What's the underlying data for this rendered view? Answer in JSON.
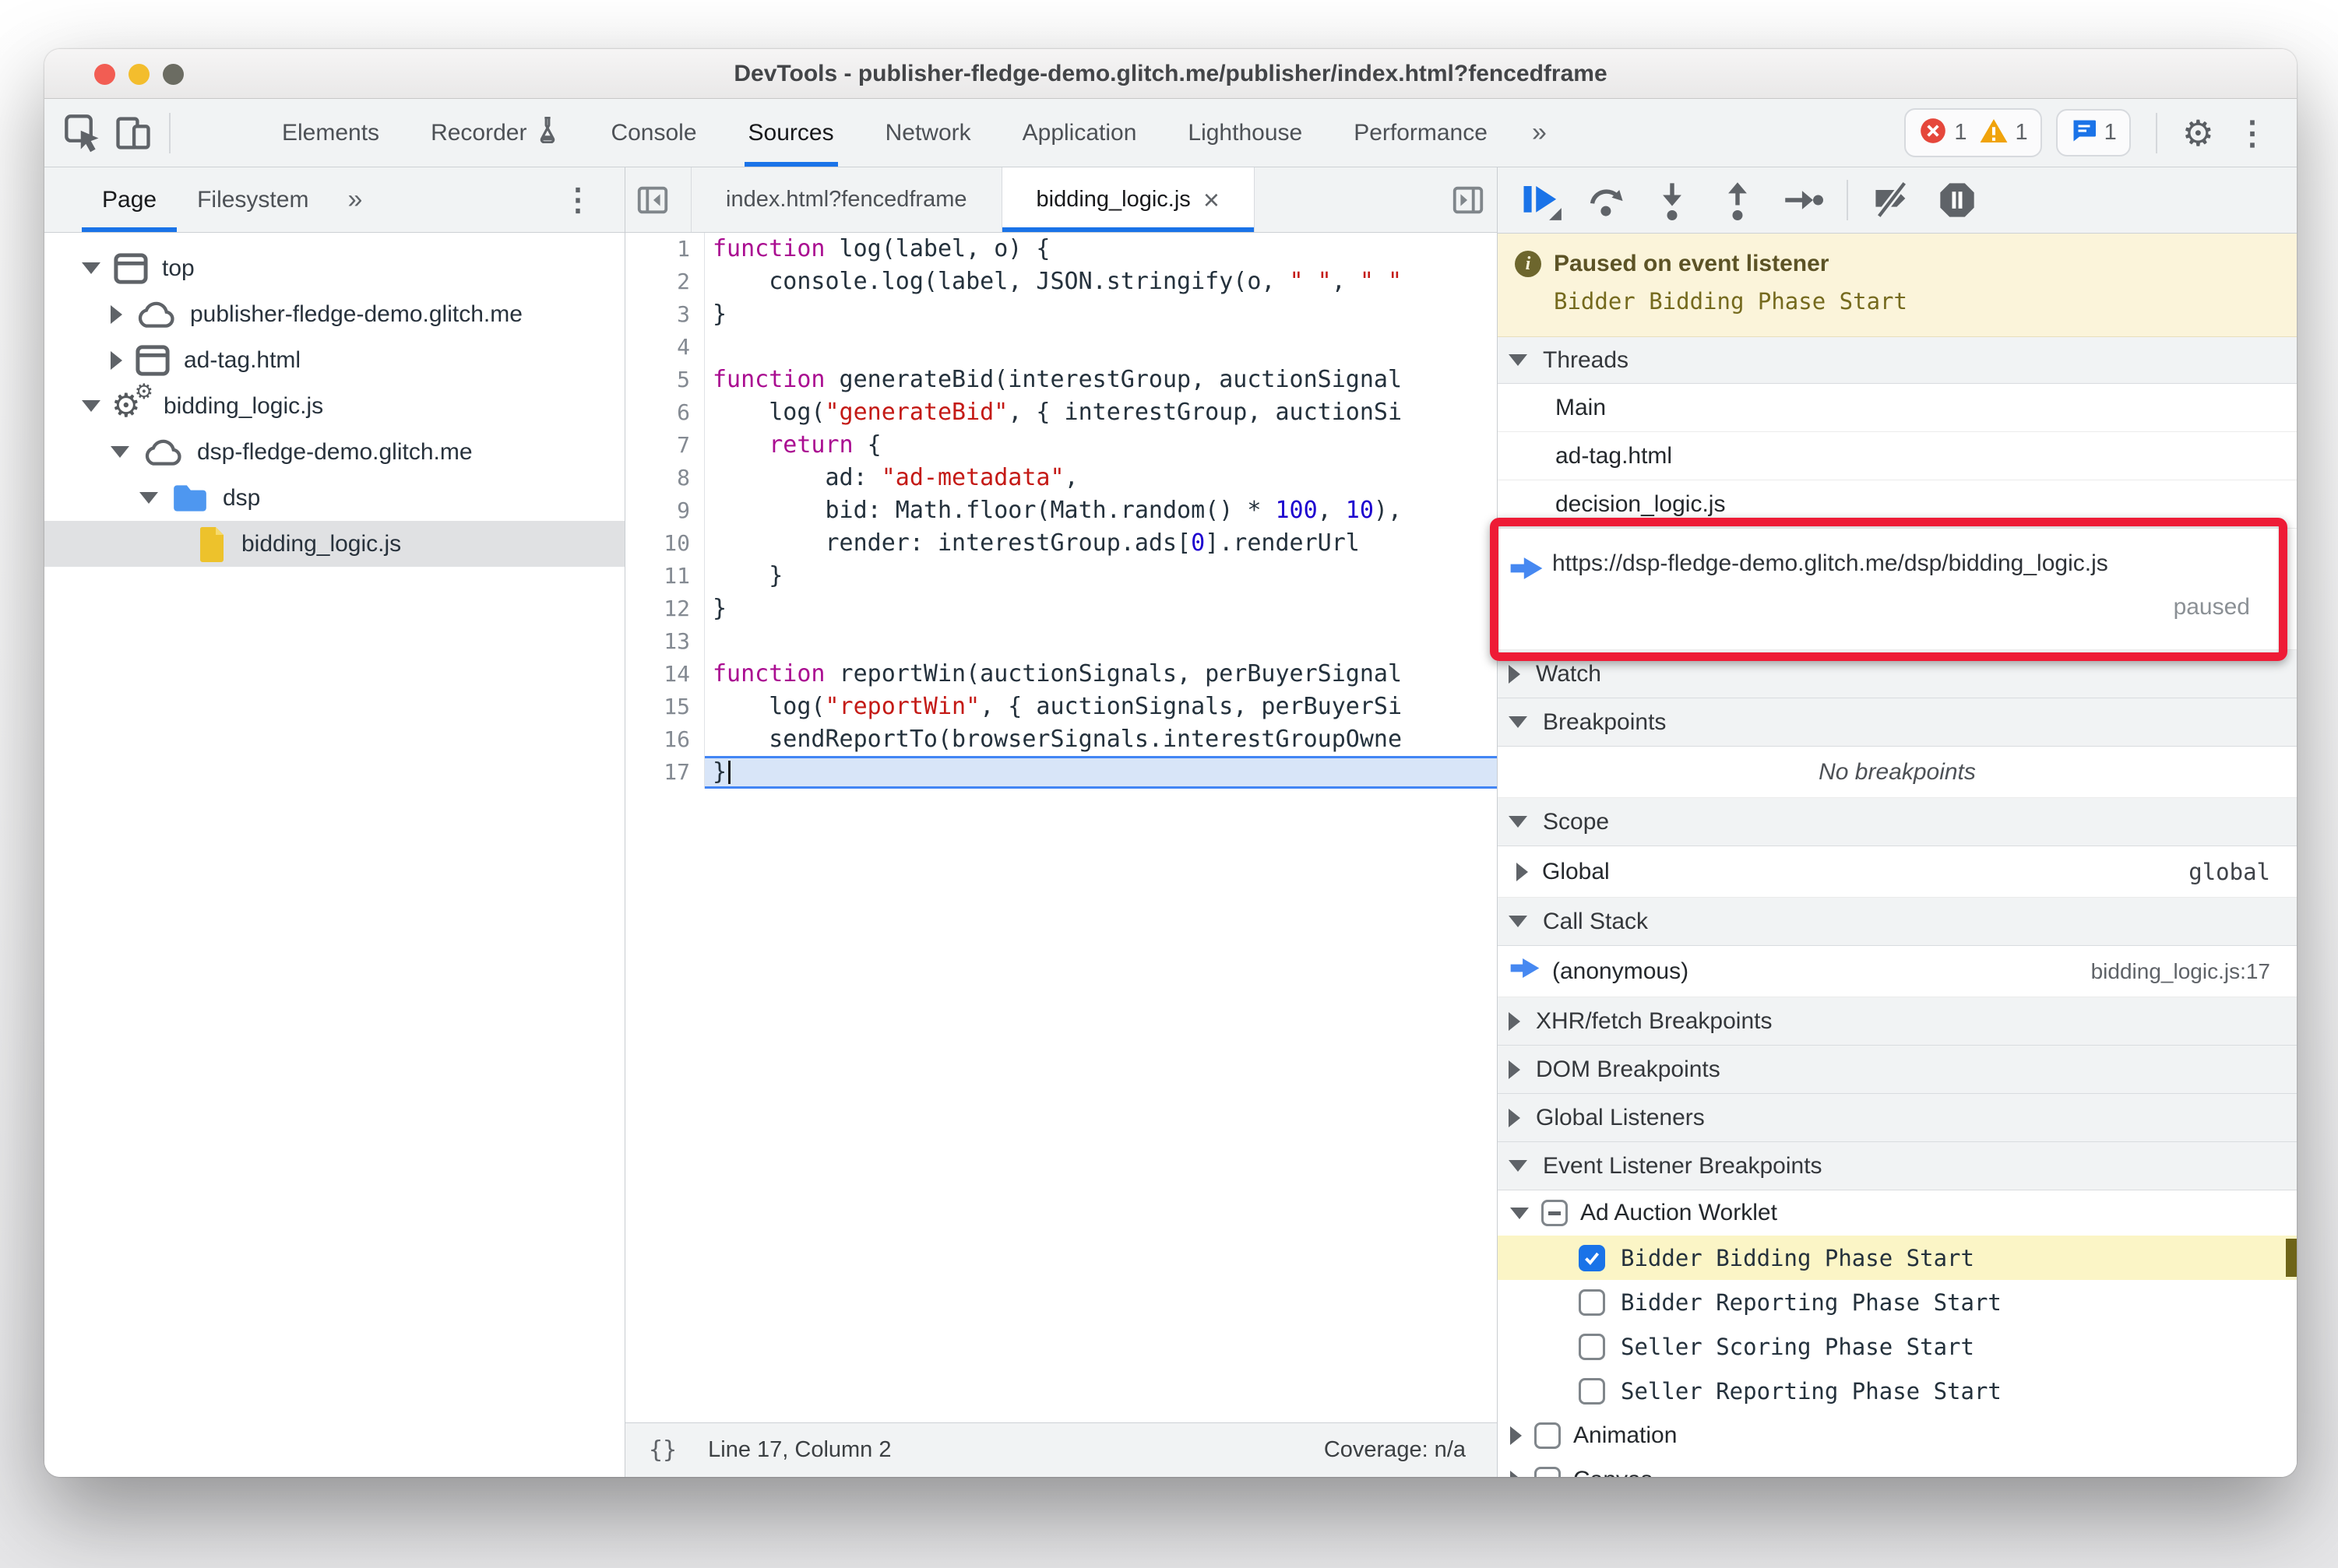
{
  "window": {
    "title": "DevTools - publisher-fledge-demo.glitch.me/publisher/index.html?fencedframe"
  },
  "toolbar": {
    "tabs": [
      {
        "label": "Elements"
      },
      {
        "label": "Recorder",
        "icon": "flask-icon"
      },
      {
        "label": "Console"
      },
      {
        "label": "Sources",
        "active": true
      },
      {
        "label": "Network"
      },
      {
        "label": "Application"
      },
      {
        "label": "Lighthouse"
      },
      {
        "label": "Performance"
      }
    ],
    "more": "»",
    "errors": "1",
    "warnings": "1",
    "issues": "1"
  },
  "navigator": {
    "tabs": [
      {
        "label": "Page",
        "active": true
      },
      {
        "label": "Filesystem",
        "active": false
      }
    ],
    "more": "»",
    "tree": [
      {
        "label": "top",
        "icon": "frame",
        "state": "expanded",
        "depth": 0
      },
      {
        "label": "publisher-fledge-demo.glitch.me",
        "icon": "cloud",
        "state": "collapsed",
        "depth": 1
      },
      {
        "label": "ad-tag.html",
        "icon": "frame",
        "state": "collapsed",
        "depth": 1
      },
      {
        "label": "bidding_logic.js",
        "icon": "worklet",
        "state": "expanded",
        "depth": 0
      },
      {
        "label": "dsp-fledge-demo.glitch.me",
        "icon": "cloud",
        "state": "expanded",
        "depth": 1
      },
      {
        "label": "dsp",
        "icon": "folder",
        "state": "expanded",
        "depth": 2
      },
      {
        "label": "bidding_logic.js",
        "icon": "file",
        "state": "leaf",
        "depth": 3,
        "selected": true
      }
    ]
  },
  "editor": {
    "tabs": [
      {
        "label": "index.html?fencedframe",
        "active": false
      },
      {
        "label": "bidding_logic.js",
        "active": true,
        "close": "×"
      }
    ],
    "code": [
      {
        "n": 1,
        "segs": [
          [
            "k",
            "function"
          ],
          [
            "p",
            " log(label, o) {"
          ]
        ]
      },
      {
        "n": 2,
        "segs": [
          [
            "p",
            "    console.log(label, JSON.stringify(o, "
          ],
          [
            "s",
            "\" \""
          ],
          [
            "p",
            ", "
          ],
          [
            "s",
            "\" \""
          ]
        ]
      },
      {
        "n": 3,
        "segs": [
          [
            "p",
            "}"
          ]
        ]
      },
      {
        "n": 4,
        "segs": []
      },
      {
        "n": 5,
        "segs": [
          [
            "k",
            "function"
          ],
          [
            "p",
            " generateBid(interestGroup, auctionSignal"
          ]
        ]
      },
      {
        "n": 6,
        "segs": [
          [
            "p",
            "    log("
          ],
          [
            "s",
            "\"generateBid\""
          ],
          [
            "p",
            ", { interestGroup, auctionSi"
          ]
        ]
      },
      {
        "n": 7,
        "segs": [
          [
            "p",
            "    "
          ],
          [
            "k",
            "return"
          ],
          [
            "p",
            " {"
          ]
        ]
      },
      {
        "n": 8,
        "segs": [
          [
            "p",
            "        ad: "
          ],
          [
            "s",
            "\"ad-metadata\""
          ],
          [
            "p",
            ","
          ]
        ]
      },
      {
        "n": 9,
        "segs": [
          [
            "p",
            "        bid: Math.floor(Math.random() * "
          ],
          [
            "n2",
            "100"
          ],
          [
            "p",
            ", "
          ],
          [
            "n2",
            "10"
          ],
          [
            "p",
            "),"
          ]
        ]
      },
      {
        "n": 10,
        "segs": [
          [
            "p",
            "        render: interestGroup.ads["
          ],
          [
            "n2",
            "0"
          ],
          [
            "p",
            "].renderUrl"
          ]
        ]
      },
      {
        "n": 11,
        "segs": [
          [
            "p",
            "    }"
          ]
        ]
      },
      {
        "n": 12,
        "segs": [
          [
            "p",
            "}"
          ]
        ]
      },
      {
        "n": 13,
        "segs": []
      },
      {
        "n": 14,
        "segs": [
          [
            "k",
            "function"
          ],
          [
            "p",
            " reportWin(auctionSignals, perBuyerSignal"
          ]
        ]
      },
      {
        "n": 15,
        "segs": [
          [
            "p",
            "    log("
          ],
          [
            "s",
            "\"reportWin\""
          ],
          [
            "p",
            ", { auctionSignals, perBuyerSi"
          ]
        ]
      },
      {
        "n": 16,
        "segs": [
          [
            "p",
            "    sendReportTo(browserSignals.interestGroupOwne"
          ]
        ]
      },
      {
        "n": 17,
        "segs": [
          [
            "p",
            "}"
          ]
        ],
        "current": true
      }
    ],
    "status": {
      "format_icon": "{}",
      "line_col": "Line 17, Column 2",
      "coverage": "Coverage: n/a"
    }
  },
  "debugger": {
    "paused": {
      "title": "Paused on event listener",
      "subtitle": "Bidder Bidding Phase Start"
    },
    "threads": {
      "label": "Threads",
      "items": [
        {
          "label": "Main"
        },
        {
          "label": "ad-tag.html"
        },
        {
          "label": "decision_logic.js"
        },
        {
          "label": "https://dsp-fledge-demo.glitch.me/dsp/bidding_logic.js",
          "status": "paused",
          "current": true
        }
      ]
    },
    "watch": {
      "label": "Watch"
    },
    "breakpoints": {
      "label": "Breakpoints",
      "empty": "No breakpoints"
    },
    "scope": {
      "label": "Scope",
      "rows": [
        {
          "label": "Global",
          "value": "global"
        }
      ]
    },
    "call_stack": {
      "label": "Call Stack",
      "rows": [
        {
          "label": "(anonymous)",
          "location": "bidding_logic.js:17",
          "current": true
        }
      ]
    },
    "xhr": {
      "label": "XHR/fetch Breakpoints"
    },
    "dom": {
      "label": "DOM Breakpoints"
    },
    "global_listeners": {
      "label": "Global Listeners"
    },
    "elb": {
      "label": "Event Listener Breakpoints",
      "category": {
        "label": "Ad Auction Worklet",
        "checkbox": "indeterminate"
      },
      "items": [
        {
          "label": "Bidder Bidding Phase Start",
          "checked": true,
          "highlighted": true
        },
        {
          "label": "Bidder Reporting Phase Start",
          "checked": false
        },
        {
          "label": "Seller Scoring Phase Start",
          "checked": false
        },
        {
          "label": "Seller Reporting Phase Start",
          "checked": false
        }
      ],
      "categories_after": [
        {
          "label": "Animation"
        },
        {
          "label": "Canvas"
        }
      ]
    },
    "annotation_color": "#ee1b36"
  }
}
